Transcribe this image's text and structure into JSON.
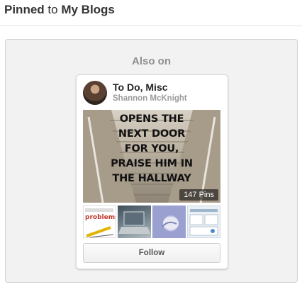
{
  "header": {
    "pinned_word": "Pinned",
    "to_word": "to",
    "board_name": "My Blogs"
  },
  "panel": {
    "heading": "Also on"
  },
  "board_card": {
    "title": "To Do, Misc",
    "owner": "Shannon McKnight",
    "image_text_lines": [
      "OPENS THE",
      "NEXT DOOR",
      "FOR YOU,",
      "PRAISE HIM IN",
      "THE HALLWAY"
    ],
    "pin_count": "147 Pins",
    "thumb1_text": "problems...",
    "follow_label": "Follow"
  }
}
